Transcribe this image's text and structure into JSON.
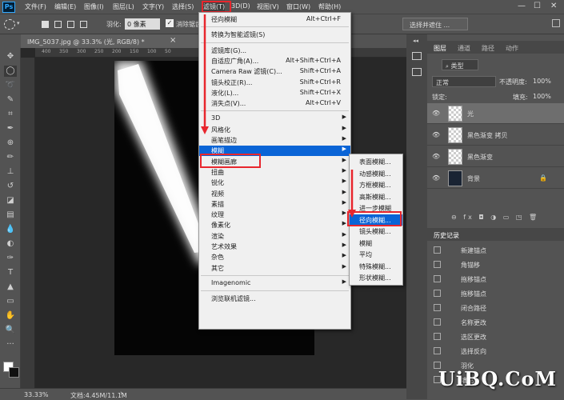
{
  "menubar": {
    "items": [
      "文件(F)",
      "编辑(E)",
      "图像(I)",
      "图层(L)",
      "文字(Y)",
      "选择(S)",
      "滤镜(T)",
      "3D(D)",
      "视图(V)",
      "窗口(W)",
      "帮助(H)"
    ],
    "ps_logo": "Ps"
  },
  "window_controls": [
    "—",
    "☐",
    "✕"
  ],
  "options": {
    "feather_label": "羽化:",
    "feather_value": "0 像素",
    "antialias_label": "消除锯齿",
    "select_mask_label": "选择并遮住 ..."
  },
  "document": {
    "tab_title": "IMG_5037.jpg @ 33.3% (光, RGB/8) *",
    "close_glyph": "×",
    "ruler_ticks": [
      "400",
      "350",
      "300",
      "250",
      "200",
      "150",
      "100",
      "50"
    ]
  },
  "status": {
    "zoom": "33.33%",
    "doc_info": "文档:4.45M/11.1M",
    "arrow": "›"
  },
  "filter_menu": {
    "items": [
      {
        "label": "径向模糊",
        "shortcut": "Alt+Ctrl+F",
        "arrow": false,
        "highlight": false
      },
      {
        "sep": true
      },
      {
        "label": "转换为智能滤镜(S)",
        "shortcut": "",
        "arrow": false,
        "highlight": false
      },
      {
        "sep": true
      },
      {
        "label": "滤镜库(G)...",
        "shortcut": "",
        "arrow": false,
        "highlight": false
      },
      {
        "label": "自适应广角(A)...",
        "shortcut": "Alt+Shift+Ctrl+A",
        "arrow": false,
        "highlight": false
      },
      {
        "label": "Camera Raw 滤镜(C)...",
        "shortcut": "Shift+Ctrl+A",
        "arrow": false,
        "highlight": false
      },
      {
        "label": "镜头校正(R)...",
        "shortcut": "Shift+Ctrl+R",
        "arrow": false,
        "highlight": false
      },
      {
        "label": "液化(L)...",
        "shortcut": "Shift+Ctrl+X",
        "arrow": false,
        "highlight": false
      },
      {
        "label": "消失点(V)...",
        "shortcut": "Alt+Ctrl+V",
        "arrow": false,
        "highlight": false
      },
      {
        "sep": true
      },
      {
        "label": "3D",
        "shortcut": "",
        "arrow": true,
        "highlight": false
      },
      {
        "label": "风格化",
        "shortcut": "",
        "arrow": true,
        "highlight": false
      },
      {
        "label": "画笔描边",
        "shortcut": "",
        "arrow": true,
        "highlight": false
      },
      {
        "label": "模糊",
        "shortcut": "",
        "arrow": true,
        "highlight": true
      },
      {
        "label": "模糊画廊",
        "shortcut": "",
        "arrow": true,
        "highlight": false
      },
      {
        "label": "扭曲",
        "shortcut": "",
        "arrow": true,
        "highlight": false
      },
      {
        "label": "锐化",
        "shortcut": "",
        "arrow": true,
        "highlight": false
      },
      {
        "label": "视频",
        "shortcut": "",
        "arrow": true,
        "highlight": false
      },
      {
        "label": "素描",
        "shortcut": "",
        "arrow": true,
        "highlight": false
      },
      {
        "label": "纹理",
        "shortcut": "",
        "arrow": true,
        "highlight": false
      },
      {
        "label": "像素化",
        "shortcut": "",
        "arrow": true,
        "highlight": false
      },
      {
        "label": "渲染",
        "shortcut": "",
        "arrow": true,
        "highlight": false
      },
      {
        "label": "艺术效果",
        "shortcut": "",
        "arrow": true,
        "highlight": false
      },
      {
        "label": "杂色",
        "shortcut": "",
        "arrow": true,
        "highlight": false
      },
      {
        "label": "其它",
        "shortcut": "",
        "arrow": true,
        "highlight": false
      },
      {
        "sep": true
      },
      {
        "label": "Imagenomic",
        "shortcut": "",
        "arrow": true,
        "highlight": false
      },
      {
        "sep": true
      },
      {
        "label": "浏览联机滤镜...",
        "shortcut": "",
        "arrow": false,
        "highlight": false
      }
    ],
    "arrow_glyph": "▶"
  },
  "blur_submenu": {
    "items": [
      {
        "label": "表面模糊...",
        "highlight": false
      },
      {
        "label": "动感模糊...",
        "highlight": false
      },
      {
        "label": "方框模糊...",
        "highlight": false
      },
      {
        "label": "高斯模糊...",
        "highlight": false
      },
      {
        "label": "进一步模糊",
        "highlight": false
      },
      {
        "label": "径向模糊...",
        "highlight": true
      },
      {
        "label": "镜头模糊...",
        "highlight": false
      },
      {
        "label": "模糊",
        "highlight": false
      },
      {
        "label": "平均",
        "highlight": false
      },
      {
        "label": "特殊模糊...",
        "highlight": false
      },
      {
        "label": "形状模糊...",
        "highlight": false
      }
    ]
  },
  "layers_panel": {
    "tabs": [
      "图层",
      "通道",
      "路径",
      "动作"
    ],
    "kind_label": "类型",
    "blend_mode": "正常",
    "opacity_label": "不透明度:",
    "opacity_value": "100%",
    "lock_label": "锁定:",
    "fill_label": "填充:",
    "fill_value": "100%",
    "layers": [
      {
        "name": "光",
        "selected": true
      },
      {
        "name": "黑色渐变 拷贝",
        "selected": false
      },
      {
        "name": "黑色渐变",
        "selected": false
      },
      {
        "name": "背景",
        "selected": false
      }
    ],
    "footer_icons": "⊖ fx ◘ ◑ ▭ ◳ 🗑"
  },
  "history_panel": {
    "title": "历史记录",
    "items": [
      "新建锚点",
      "角锚移",
      "拖移锚点",
      "拖移锚点",
      "闭合路径",
      "名称更改",
      "选区更改",
      "选择反向",
      "羽化",
      "填充"
    ]
  },
  "watermark": "UiBQ.CoM",
  "colors": {
    "highlight": "#0a64d6",
    "annotation_red": "#e8262d",
    "panel_bg": "#535353",
    "canvas_bg": "#282828"
  }
}
